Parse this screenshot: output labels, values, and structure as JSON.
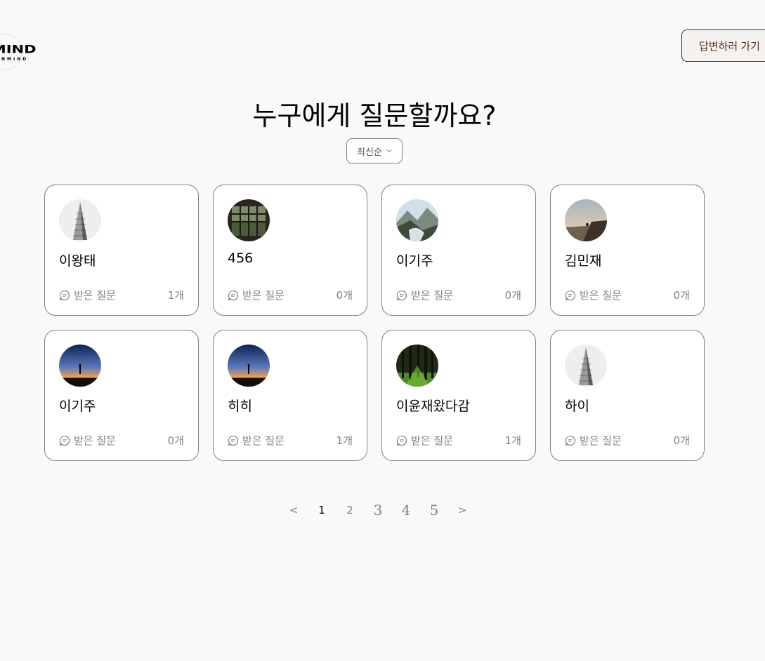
{
  "logo": {
    "word": "IMIND",
    "sub": "NMIND"
  },
  "header": {
    "answer_button": "답변하러 가기"
  },
  "main": {
    "title": "누구에게 질문할까요?",
    "sort_label": "최신순",
    "question_label": "받은 질문"
  },
  "cards": [
    {
      "name": "이왕태",
      "count": "1개",
      "avatar": "building"
    },
    {
      "name": "456",
      "count": "0개",
      "avatar": "window"
    },
    {
      "name": "이기주",
      "count": "0개",
      "avatar": "mountain"
    },
    {
      "name": "김민재",
      "count": "0개",
      "avatar": "sunset-cliff"
    },
    {
      "name": "이기주",
      "count": "0개",
      "avatar": "dusk-silhouette"
    },
    {
      "name": "히히",
      "count": "1개",
      "avatar": "dusk-silhouette"
    },
    {
      "name": "이윤재왔다감",
      "count": "1개",
      "avatar": "forest"
    },
    {
      "name": "하이",
      "count": "0개",
      "avatar": "building"
    }
  ],
  "pagination": {
    "prev": "<",
    "pages": [
      "1",
      "2",
      "3",
      "4",
      "5"
    ],
    "next": ">",
    "current": "1"
  },
  "colors": {
    "brown": "#542f1a",
    "gray": "#818181",
    "bg": "#f9f9f9"
  }
}
